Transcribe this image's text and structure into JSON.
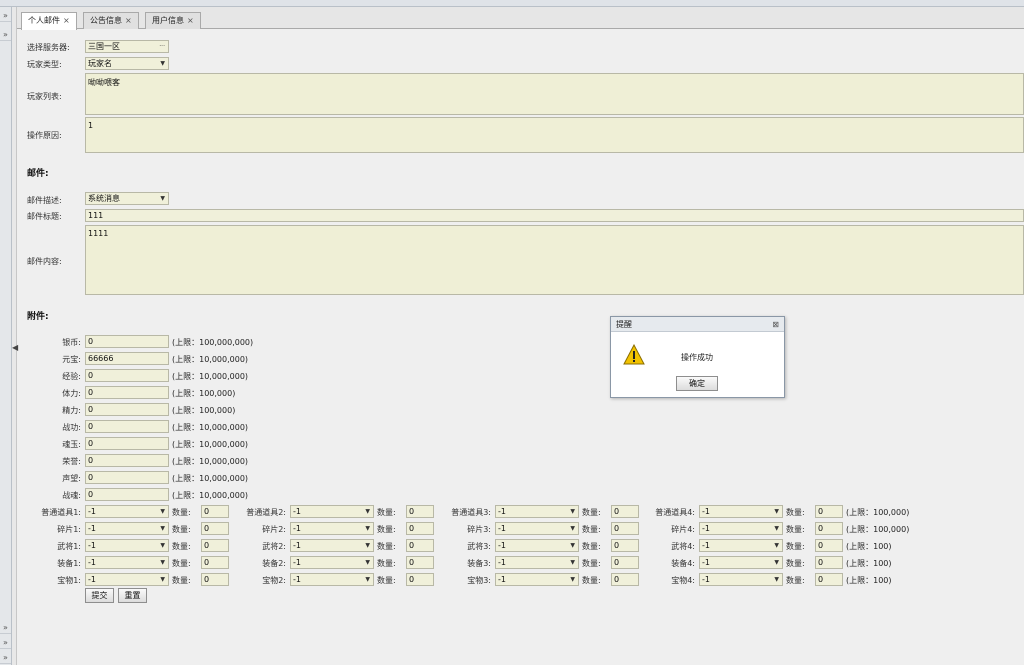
{
  "tabs": [
    {
      "label": "个人邮件",
      "close": "×"
    },
    {
      "label": "公告信息",
      "close": "×"
    },
    {
      "label": "用户信息",
      "close": "×"
    }
  ],
  "left_icons": {
    "collapse_up": "»",
    "collapse_down": "»",
    "handle": "◀"
  },
  "form": {
    "server_label": "选择服务器:",
    "server_value": "三国一区",
    "server_btn": "···",
    "player_type_label": "玩家类型:",
    "player_type_value": "玩家名",
    "player_list_label": "玩家列表:",
    "player_list_value": "呦呦喂客",
    "reason_label": "操作原因:",
    "reason_value": "1"
  },
  "mail": {
    "title": "邮件:",
    "desc_label": "邮件描述:",
    "desc_value": "系统消息",
    "subject_label": "邮件标题:",
    "subject_value": "111",
    "content_label": "邮件内容:",
    "content_value": "1111"
  },
  "attach": {
    "title": "附件:",
    "rows": [
      {
        "label": "银币:",
        "value": "0",
        "limit": "(上限：100,000,000)"
      },
      {
        "label": "元宝:",
        "value": "66666",
        "limit": "(上限：10,000,000)"
      },
      {
        "label": "经验:",
        "value": "0",
        "limit": "(上限：10,000,000)"
      },
      {
        "label": "体力:",
        "value": "0",
        "limit": "(上限：100,000)"
      },
      {
        "label": "精力:",
        "value": "0",
        "limit": "(上限：100,000)"
      },
      {
        "label": "战功:",
        "value": "0",
        "limit": "(上限：10,000,000)"
      },
      {
        "label": "魂玉:",
        "value": "0",
        "limit": "(上限：10,000,000)"
      },
      {
        "label": "荣誉:",
        "value": "0",
        "limit": "(上限：10,000,000)"
      },
      {
        "label": "声望:",
        "value": "0",
        "limit": "(上限：10,000,000)"
      },
      {
        "label": "战魂:",
        "value": "0",
        "limit": "(上限：10,000,000)"
      }
    ],
    "qty_label": "数量:",
    "item_rows": [
      {
        "names": [
          "普通道具1:",
          "普通道具2:",
          "普通道具3:",
          "普通道具4:"
        ],
        "select": "-1",
        "qty": "0",
        "limit": "(上限：100,000)"
      },
      {
        "names": [
          "碎片1:",
          "碎片2:",
          "碎片3:",
          "碎片4:"
        ],
        "select": "-1",
        "qty": "0",
        "limit": "(上限：100,000)"
      },
      {
        "names": [
          "武将1:",
          "武将2:",
          "武将3:",
          "武将4:"
        ],
        "select": "-1",
        "qty": "0",
        "limit": "(上限：100)"
      },
      {
        "names": [
          "装备1:",
          "装备2:",
          "装备3:",
          "装备4:"
        ],
        "select": "-1",
        "qty": "0",
        "limit": "(上限：100)"
      },
      {
        "names": [
          "宝物1:",
          "宝物2:",
          "宝物3:",
          "宝物4:"
        ],
        "select": "-1",
        "qty": "0",
        "limit": "(上限：100)"
      }
    ],
    "submit": "提交",
    "reset": "重置"
  },
  "dialog": {
    "title": "提醒",
    "close": "⊠",
    "message": "操作成功",
    "ok": "确定",
    "accent": "#f2c200"
  }
}
